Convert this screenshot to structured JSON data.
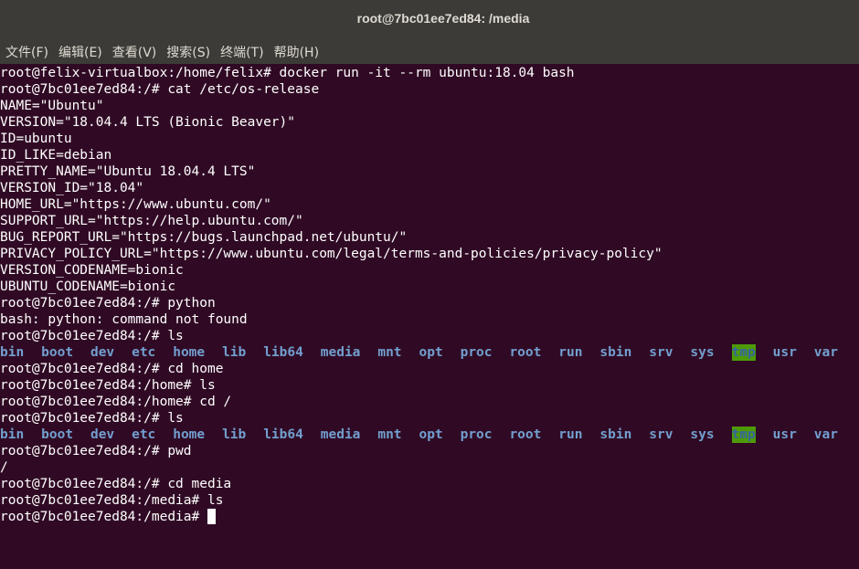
{
  "window": {
    "title": "root@7bc01ee7ed84: /media"
  },
  "menu": [
    "文件(F)",
    "编辑(E)",
    "查看(V)",
    "搜索(S)",
    "终端(T)",
    "帮助(H)"
  ],
  "colors": {
    "background": "#300a24",
    "directory": "#729fcf",
    "sticky_bg": "#4e9a06",
    "chrome": "#3c3b37"
  },
  "terminal": {
    "lines_top": [
      "root@felix-virtualbox:/home/felix# docker run -it --rm ubuntu:18.04 bash",
      "root@7bc01ee7ed84:/# cat /etc/os-release",
      "NAME=\"Ubuntu\"",
      "VERSION=\"18.04.4 LTS (Bionic Beaver)\"",
      "ID=ubuntu",
      "ID_LIKE=debian",
      "PRETTY_NAME=\"Ubuntu 18.04.4 LTS\"",
      "VERSION_ID=\"18.04\"",
      "HOME_URL=\"https://www.ubuntu.com/\"",
      "SUPPORT_URL=\"https://help.ubuntu.com/\"",
      "BUG_REPORT_URL=\"https://bugs.launchpad.net/ubuntu/\"",
      "PRIVACY_POLICY_URL=\"https://www.ubuntu.com/legal/terms-and-policies/privacy-policy\"",
      "VERSION_CODENAME=bionic",
      "UBUNTU_CODENAME=bionic",
      "root@7bc01ee7ed84:/# python",
      "bash: python: command not found",
      "root@7bc01ee7ed84:/# ls"
    ],
    "dirs": [
      "bin",
      "boot",
      "dev",
      "etc",
      "home",
      "lib",
      "lib64",
      "media",
      "mnt",
      "opt",
      "proc",
      "root",
      "run",
      "sbin",
      "srv",
      "sys",
      "tmp",
      "usr",
      "var"
    ],
    "lines_mid": [
      "root@7bc01ee7ed84:/# cd home",
      "root@7bc01ee7ed84:/home# ls",
      "root@7bc01ee7ed84:/home# cd /",
      "root@7bc01ee7ed84:/# ls"
    ],
    "lines_bottom": [
      "root@7bc01ee7ed84:/# pwd",
      "/",
      "root@7bc01ee7ed84:/# cd media",
      "root@7bc01ee7ed84:/media# ls"
    ],
    "prompt": "root@7bc01ee7ed84:/media# "
  }
}
